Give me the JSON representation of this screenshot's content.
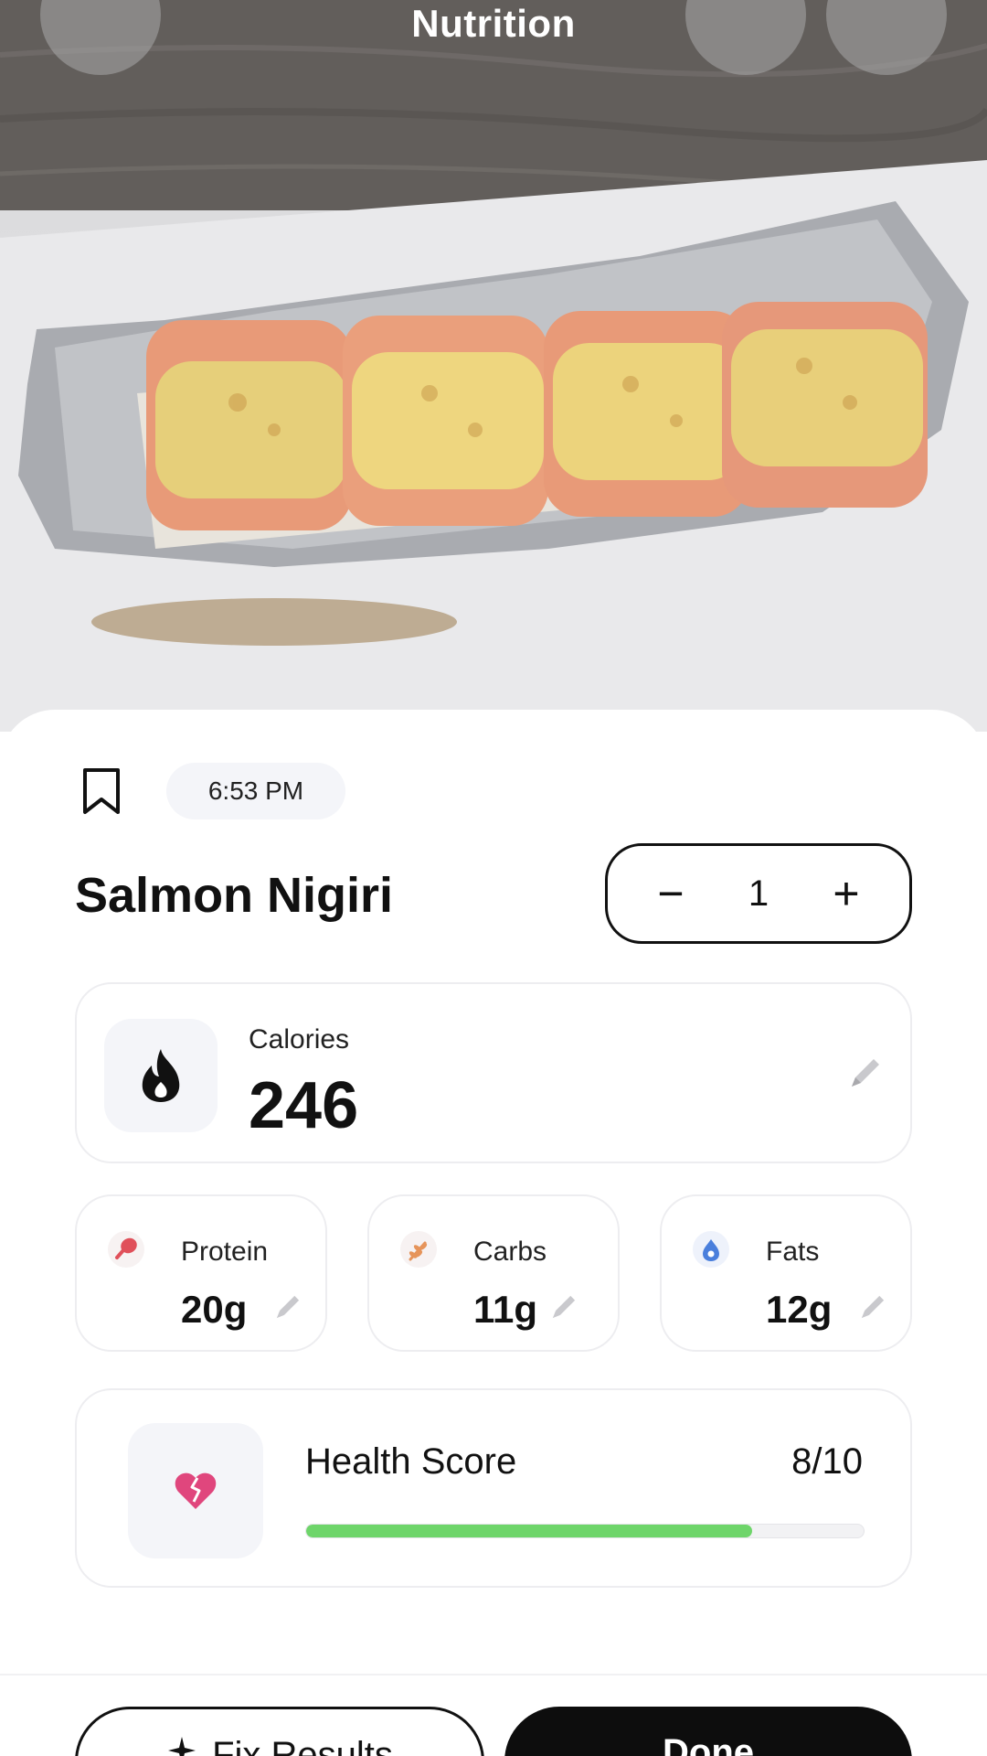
{
  "header": {
    "title": "Nutrition"
  },
  "entry": {
    "time": "6:53 PM",
    "food_name": "Salmon Nigiri",
    "quantity": "1",
    "minus": "−",
    "plus": "+"
  },
  "calories": {
    "label": "Calories",
    "value": "246"
  },
  "macros": [
    {
      "label": "Protein",
      "value": "20g",
      "icon": "drumstick-icon",
      "color": "#e0505a"
    },
    {
      "label": "Carbs",
      "value": "11g",
      "icon": "wheat-icon",
      "color": "#e6945a"
    },
    {
      "label": "Fats",
      "value": "12g",
      "icon": "oil-drop-icon",
      "color": "#4a7fdc"
    }
  ],
  "health": {
    "label": "Health Score",
    "score": "8/10",
    "fraction": 0.8,
    "icon": "broken-heart-icon",
    "icon_color": "#e0467d",
    "bar_color": "#6ed56a"
  },
  "actions": {
    "fix_label": "Fix Results",
    "done_label": "Done"
  }
}
